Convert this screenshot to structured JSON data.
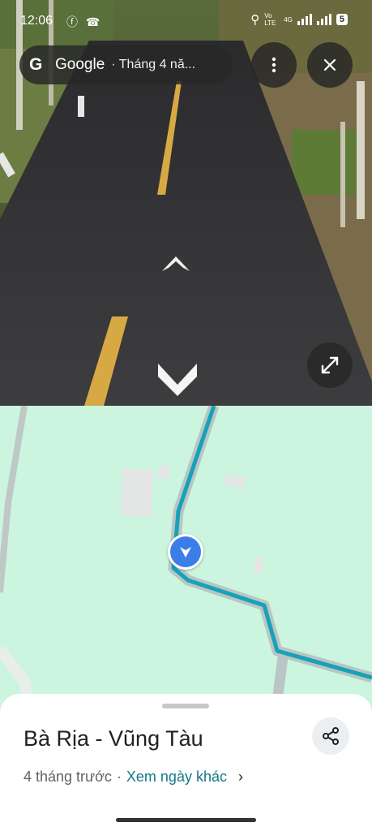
{
  "status_bar": {
    "time": "12:06",
    "left_icons": [
      "facebook-icon",
      "missed-call-icon"
    ],
    "carrier_text": "Vo LTE",
    "network": "4G",
    "battery": "5"
  },
  "top_bar": {
    "brand": "Google",
    "date_label": "· Tháng 4 nă..."
  },
  "controls": {
    "menu_icon": "more-vert-icon",
    "close_icon": "close-icon",
    "expand_icon": "fullscreen-icon",
    "forward_arrow_icon": "chevron-up-icon",
    "back_arrow_icon": "chevron-down-icon"
  },
  "map": {
    "background_color": "#ccf5df",
    "route_color": "#17a2b8",
    "marker_color": "#3b7ee8"
  },
  "bottom_sheet": {
    "title": "Bà Rịa - Vũng Tàu",
    "time_ago": "4 tháng trước",
    "separator": "·",
    "link_label": "Xem ngày khác",
    "chevron": "›",
    "share_icon": "share-icon"
  }
}
